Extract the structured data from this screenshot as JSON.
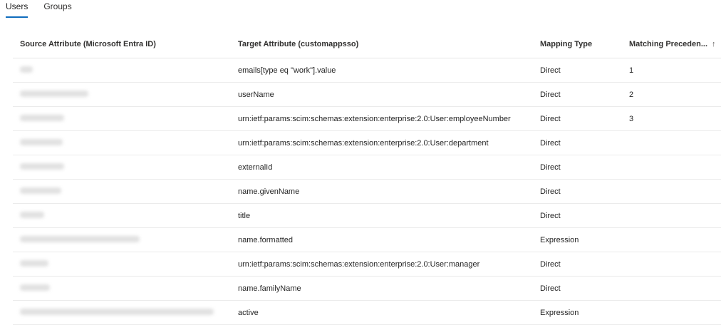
{
  "tabs": [
    {
      "label": "Users",
      "active": true
    },
    {
      "label": "Groups",
      "active": false
    }
  ],
  "columns": {
    "source": "Source Attribute (Microsoft Entra ID)",
    "target": "Target Attribute (customappsso)",
    "mapping": "Mapping Type",
    "precedence": "Matching Preceden...",
    "sort_icon": "↑"
  },
  "accent_color": "#0f6cbd",
  "rows": [
    {
      "target": "emails[type eq \"work\"].value",
      "mapping": "Direct",
      "precedence": "1"
    },
    {
      "target": "userName",
      "mapping": "Direct",
      "precedence": "2"
    },
    {
      "target": "urn:ietf:params:scim:schemas:extension:enterprise:2.0:User:employeeNumber",
      "mapping": "Direct",
      "precedence": "3"
    },
    {
      "target": "urn:ietf:params:scim:schemas:extension:enterprise:2.0:User:department",
      "mapping": "Direct",
      "precedence": ""
    },
    {
      "target": "externalId",
      "mapping": "Direct",
      "precedence": ""
    },
    {
      "target": "name.givenName",
      "mapping": "Direct",
      "precedence": ""
    },
    {
      "target": "title",
      "mapping": "Direct",
      "precedence": ""
    },
    {
      "target": "name.formatted",
      "mapping": "Expression",
      "precedence": ""
    },
    {
      "target": "urn:ietf:params:scim:schemas:extension:enterprise:2.0:User:manager",
      "mapping": "Direct",
      "precedence": ""
    },
    {
      "target": "name.familyName",
      "mapping": "Direct",
      "precedence": ""
    },
    {
      "target": "active",
      "mapping": "Expression",
      "precedence": ""
    }
  ]
}
